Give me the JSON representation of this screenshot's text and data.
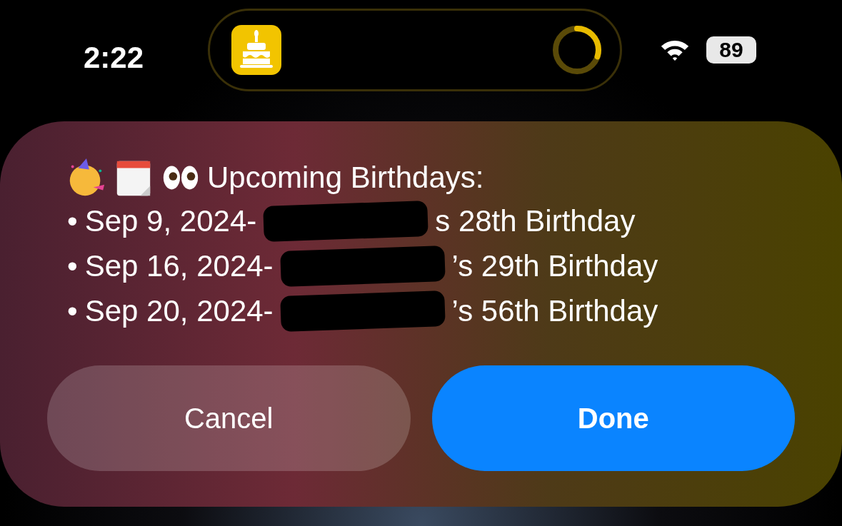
{
  "status_bar": {
    "time": "2:22",
    "battery": "89"
  },
  "live_activity": {
    "progress": {
      "level": 0.3
    }
  },
  "alert": {
    "title": "Upcoming Birthdays:",
    "items": [
      {
        "bullet": "•",
        "date": "Sep 9, 2024-",
        "redacted": true,
        "rest": "s 28th Birthday"
      },
      {
        "bullet": "•",
        "date": "Sep 16, 2024-",
        "redacted": true,
        "rest": "’s 29th Birthday"
      },
      {
        "bullet": "•",
        "date": "Sep 20, 2024-",
        "redacted": true,
        "rest": "’s 56th Birthday"
      }
    ],
    "buttons": [
      {
        "label": "Cancel",
        "kind": "cancel"
      },
      {
        "label": "Done",
        "kind": "primary"
      }
    ]
  }
}
